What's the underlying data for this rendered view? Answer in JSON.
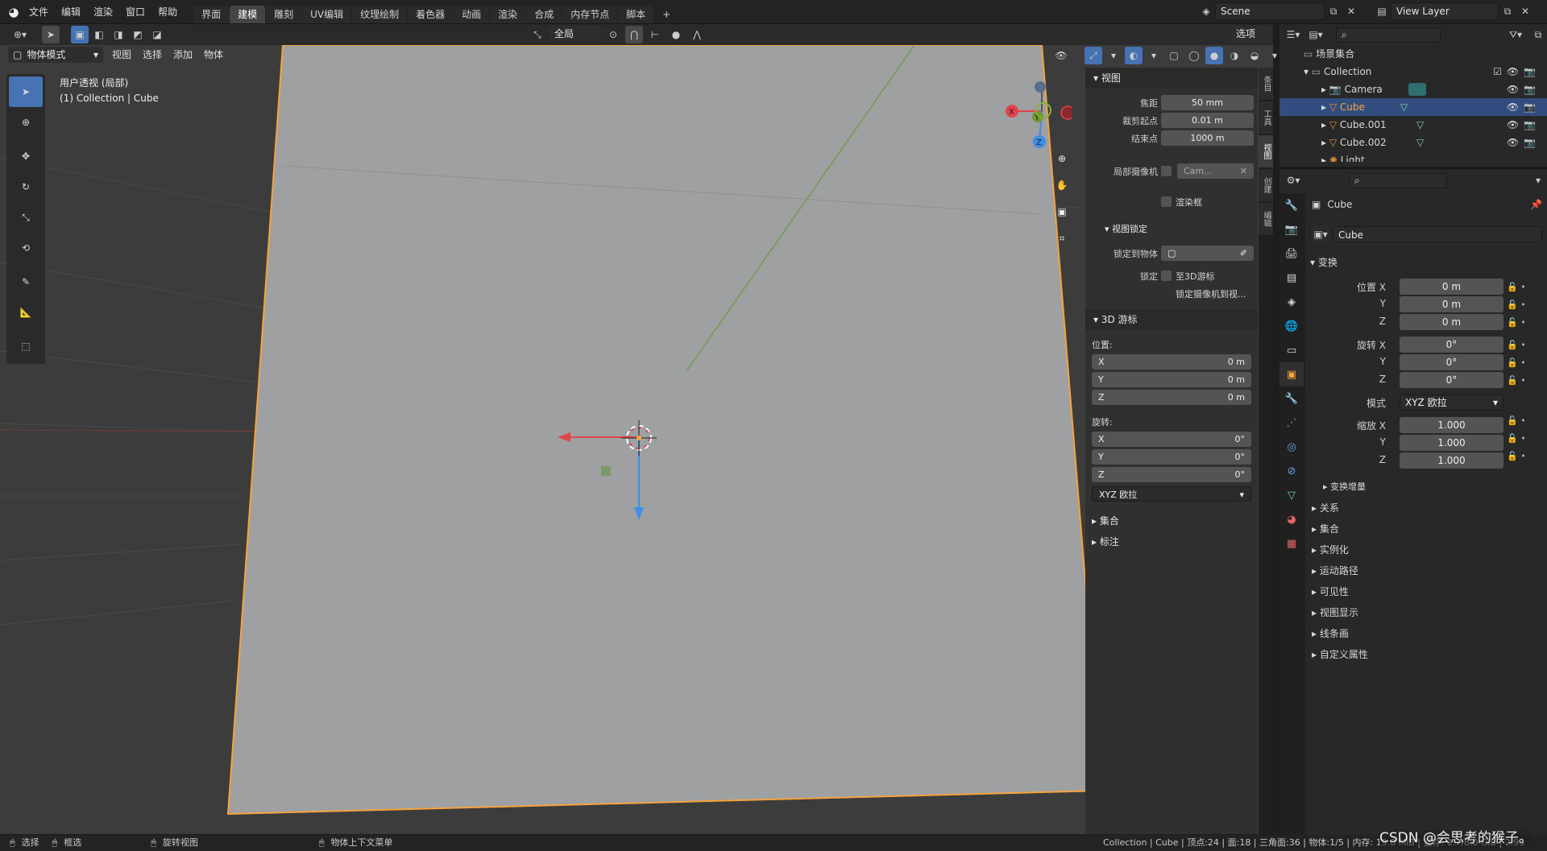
{
  "topbar": {
    "menus": [
      "文件",
      "编辑",
      "渲染",
      "窗口",
      "帮助"
    ],
    "workspace_tabs": [
      "界面",
      "建模",
      "雕刻",
      "UV编辑",
      "纹理绘制",
      "着色器",
      "动画",
      "渲染",
      "合成",
      "内存节点",
      "脚本"
    ],
    "active_tab": "建模",
    "add_tab": "+",
    "scene_name": "Scene",
    "view_layer": "View Layer"
  },
  "viewport_header": {
    "mode": "物体模式",
    "menus": [
      "视图",
      "选择",
      "添加",
      "物体"
    ],
    "transform_orientation": "全局",
    "options_label": "选项"
  },
  "viewport": {
    "view_name": "用户透视 (局部)",
    "collection_info": "(1) Collection | Cube",
    "gizmo_axes": [
      "X",
      "Y",
      "Z"
    ]
  },
  "npanel": {
    "view_section": "视图",
    "focal_label": "焦距",
    "focal_value": "50 mm",
    "clip_start_label": "裁剪起点",
    "clip_start_value": "0.01 m",
    "clip_end_label": "结束点",
    "clip_end_value": "1000 m",
    "local_camera_label": "局部摄像机",
    "local_camera_value": "Cam...",
    "render_region_label": "渲染框",
    "view_lock_section": "视图锁定",
    "lock_object_label": "锁定到物体",
    "lock_label": "锁定",
    "lock_cursor_label": "至3D游标",
    "lock_camera_label": "锁定摄像机到视...",
    "cursor_section": "3D 游标",
    "location_label": "位置:",
    "rotation_label": "旋转:",
    "cursor_loc": [
      {
        "axis": "X",
        "value": "0 m"
      },
      {
        "axis": "Y",
        "value": "0 m"
      },
      {
        "axis": "Z",
        "value": "0 m"
      }
    ],
    "cursor_rot": [
      {
        "axis": "X",
        "value": "0°"
      },
      {
        "axis": "Y",
        "value": "0°"
      },
      {
        "axis": "Z",
        "value": "0°"
      }
    ],
    "rotation_mode": "XYZ 欧拉",
    "collection_section": "集合",
    "annotation_section": "标注",
    "side_tabs": [
      "条目",
      "工具",
      "视图",
      "创建",
      "编辑"
    ]
  },
  "outliner": {
    "root": "场景集合",
    "collection": "Collection",
    "items": [
      {
        "name": "Camera",
        "selected": false,
        "color": "#e08d3c"
      },
      {
        "name": "Cube",
        "selected": true,
        "color": "#e08d3c"
      },
      {
        "name": "Cube.001",
        "selected": false,
        "color": "#e08d3c"
      },
      {
        "name": "Cube.002",
        "selected": false,
        "color": "#e08d3c"
      },
      {
        "name": "Light",
        "selected": false,
        "color": "#e08d3c"
      }
    ]
  },
  "properties": {
    "object_name": "Cube",
    "data_name": "Cube",
    "transform_section": "变换",
    "location_label": "位置 X",
    "rotation_label": "旋转 X",
    "scale_label": "缩放 X",
    "mode_label": "模式",
    "mode_value": "XYZ 欧拉",
    "axis_y": "Y",
    "axis_z": "Z",
    "location": [
      "0 m",
      "0 m",
      "0 m"
    ],
    "rotation": [
      "0°",
      "0°",
      "0°"
    ],
    "scale": [
      "1.000",
      "1.000",
      "1.000"
    ],
    "delta_transform": "变换增量",
    "sections": [
      "关系",
      "集合",
      "实例化",
      "运动路径",
      "可见性",
      "视图显示",
      "线条画",
      "自定义属性"
    ]
  },
  "statusbar": {
    "select": "选择",
    "box_select": "框选",
    "rotate_view": "旋转视图",
    "context_menu": "物体上下文菜单",
    "stats": "Collection | Cube | 顶点:24 | 面:18 | 三角面:36 | 物体:1/5 | 内存: 19.8 MiB | 显存: 1.7/8.0 GiB | 2.93",
    "watermark": "CSDN @会思考的猴子。"
  },
  "colors": {
    "accent_blue": "#4772b3",
    "selection_orange": "#f7a33c",
    "axis_x": "#e3444b",
    "axis_y": "#8ab13c",
    "axis_z": "#3e8ee6"
  }
}
